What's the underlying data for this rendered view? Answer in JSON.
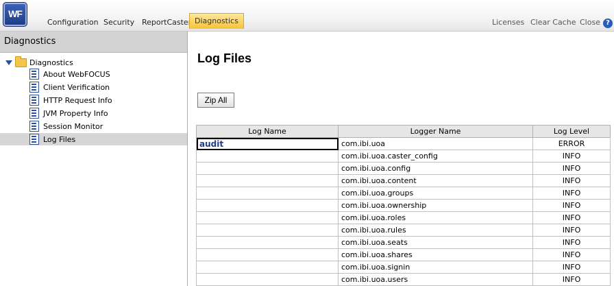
{
  "app": {
    "logo_text": "WF"
  },
  "tabs": [
    {
      "label": "Configuration",
      "active": false
    },
    {
      "label": "Security",
      "active": false
    },
    {
      "label": "ReportCaster",
      "active": false
    },
    {
      "label": "Diagnostics",
      "active": true
    }
  ],
  "top_links": {
    "licenses": "Licenses",
    "clear_cache": "Clear Cache",
    "close": "Close",
    "help": "?"
  },
  "sidebar": {
    "header": "Diagnostics",
    "root": "Diagnostics",
    "items": [
      {
        "label": "About WebFOCUS",
        "selected": false
      },
      {
        "label": "Client Verification",
        "selected": false
      },
      {
        "label": "HTTP Request Info",
        "selected": false
      },
      {
        "label": "JVM Property Info",
        "selected": false
      },
      {
        "label": "Session Monitor",
        "selected": false
      },
      {
        "label": "Log Files",
        "selected": true
      }
    ]
  },
  "main": {
    "title": "Log Files",
    "zip_button": "Zip All",
    "table": {
      "headers": [
        "Log Name",
        "Logger Name",
        "Log Level"
      ],
      "rows": [
        {
          "log_name": "audit",
          "logger": "com.ibi.uoa",
          "level": "ERROR"
        },
        {
          "log_name": "",
          "logger": "com.ibi.uoa.caster_config",
          "level": "INFO"
        },
        {
          "log_name": "",
          "logger": "com.ibi.uoa.config",
          "level": "INFO"
        },
        {
          "log_name": "",
          "logger": "com.ibi.uoa.content",
          "level": "INFO"
        },
        {
          "log_name": "",
          "logger": "com.ibi.uoa.groups",
          "level": "INFO"
        },
        {
          "log_name": "",
          "logger": "com.ibi.uoa.ownership",
          "level": "INFO"
        },
        {
          "log_name": "",
          "logger": "com.ibi.uoa.roles",
          "level": "INFO"
        },
        {
          "log_name": "",
          "logger": "com.ibi.uoa.rules",
          "level": "INFO"
        },
        {
          "log_name": "",
          "logger": "com.ibi.uoa.seats",
          "level": "INFO"
        },
        {
          "log_name": "",
          "logger": "com.ibi.uoa.shares",
          "level": "INFO"
        },
        {
          "log_name": "",
          "logger": "com.ibi.uoa.signin",
          "level": "INFO"
        },
        {
          "log_name": "",
          "logger": "com.ibi.uoa.users",
          "level": "INFO"
        }
      ]
    }
  },
  "colors": {
    "active_tab": "#f7c23a",
    "link": "#1d3c8a",
    "sidebar_header": "#d3d3d3"
  }
}
